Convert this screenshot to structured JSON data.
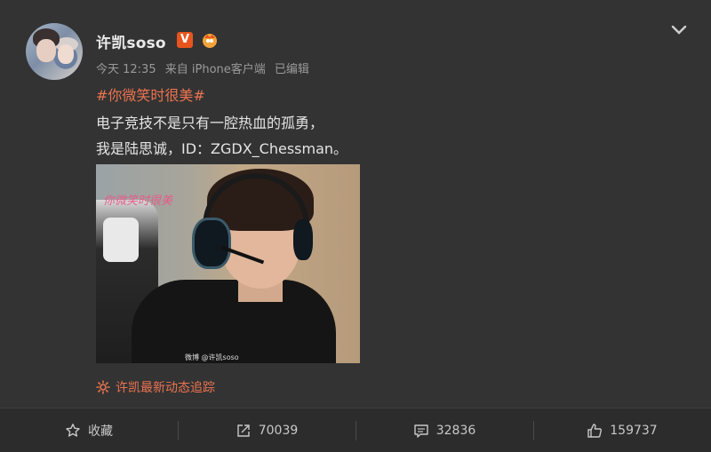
{
  "post": {
    "author": "许凯soso",
    "verified_badge": "V",
    "timestamp": "今天 12:35",
    "source": "来自 iPhone客户端",
    "edited": "已编辑",
    "topic": "#你微笑时很美#",
    "text_line1": "电子竞技不是只有一腔热血的孤勇，",
    "text_line2": "我是陆思诚，ID：ZGDX_Chessman。",
    "image": {
      "caption": "你微笑时很美",
      "watermark": "微博 @许凯soso"
    },
    "follow_link": "许凯最新动态追踪"
  },
  "actions": {
    "favorite_label": "收藏",
    "repost_count": "70039",
    "comment_count": "32836",
    "like_count": "159737"
  },
  "colors": {
    "background": "#333333",
    "accent": "#eb7350",
    "badge": "#e8541e"
  },
  "icons": {
    "favorite": "star-icon",
    "repost": "share-icon",
    "comment": "comment-icon",
    "like": "thumbs-up-icon",
    "menu": "chevron-down-icon"
  }
}
